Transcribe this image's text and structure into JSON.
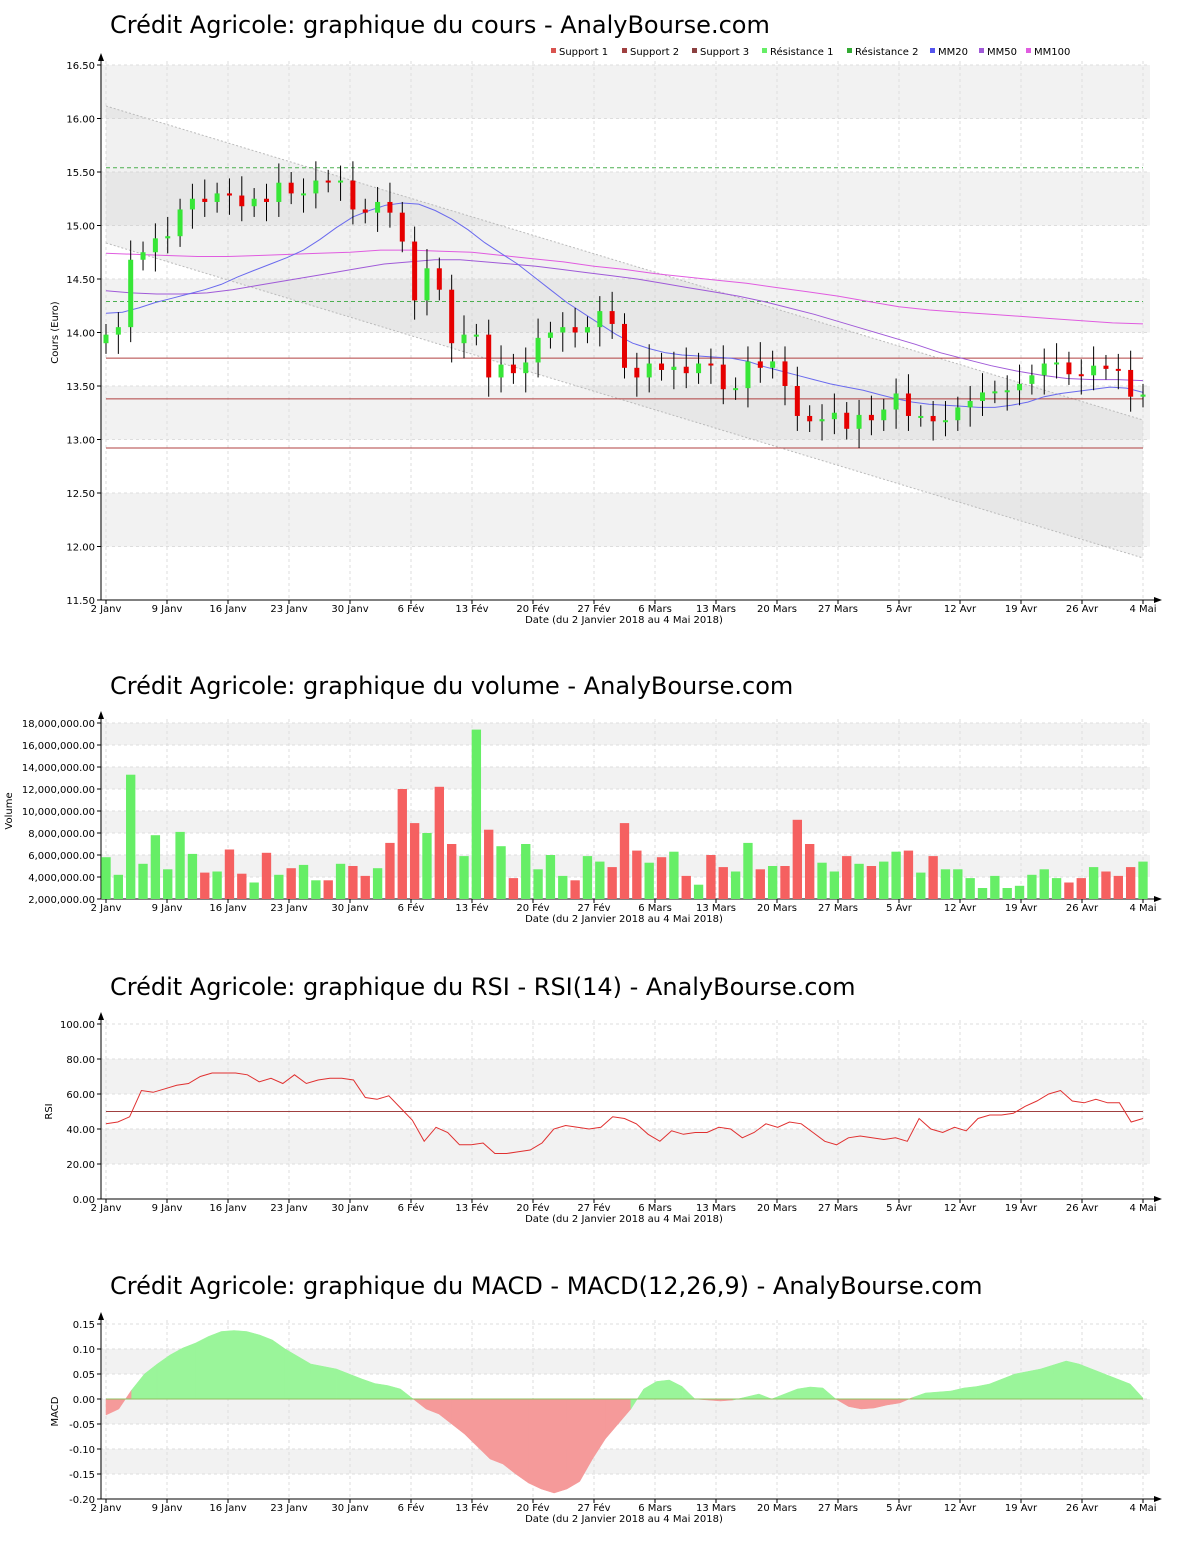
{
  "xaxis": {
    "label": "Date (du 2 Janvier 2018 au 4 Mai 2018)",
    "ticks": [
      "2 Janv",
      "9 Janv",
      "16 Janv",
      "23 Janv",
      "30 Janv",
      "6 Fév",
      "13 Fév",
      "20 Fév",
      "27 Fév",
      "6 Mars",
      "13 Mars",
      "20 Mars",
      "27 Mars",
      "5 Avr",
      "12 Avr",
      "19 Avr",
      "26 Avr",
      "4 Mai"
    ]
  },
  "colors": {
    "up": "#37e637",
    "down": "#e60000",
    "support": "#b04040",
    "resistance": "#4caf50",
    "mm20": "#6a6aee",
    "mm50": "#a05ad8",
    "mm100": "#e05ce0",
    "rsi": "#e03030",
    "macd_pos": "#9af59a",
    "macd_neg": "#f59a9a",
    "vol_up": "#66ee66",
    "vol_down": "#f56060"
  },
  "chart_data": [
    {
      "type": "candlestick",
      "title": "Crédit Agricole: graphique du cours - AnalyBourse.com",
      "ylabel": "Cours (Euro)",
      "xlabel": "Date (du 2 Janvier 2018 au 4 Mai 2018)",
      "ylim": [
        11.5,
        16.5
      ],
      "yticks": [
        "11.50",
        "12.00",
        "12.50",
        "13.00",
        "13.50",
        "14.00",
        "14.50",
        "15.00",
        "15.50",
        "16.00",
        "16.50"
      ],
      "legend": [
        "Support 1",
        "Support 2",
        "Support 3",
        "Résistance 1",
        "Résistance 2",
        "MM20",
        "MM50",
        "MM100"
      ],
      "legend_colors": [
        "#d9534f",
        "#a04040",
        "#8b4040",
        "#66ee66",
        "#33aa33",
        "#5555ee",
        "#a05ad8",
        "#e05ce0"
      ],
      "legend_position": "top-right",
      "support": [
        13.76,
        13.38,
        12.92
      ],
      "resistance": [
        14.29,
        15.54
      ],
      "close": [
        13.98,
        14.05,
        14.68,
        14.75,
        14.88,
        14.9,
        15.15,
        15.25,
        15.22,
        15.3,
        15.28,
        15.18,
        15.25,
        15.22,
        15.4,
        15.3,
        15.3,
        15.42,
        15.41,
        15.42,
        15.15,
        15.12,
        15.22,
        15.12,
        14.85,
        14.3,
        14.6,
        14.4,
        13.9,
        13.98,
        13.98,
        13.58,
        13.7,
        13.62,
        13.72,
        13.95,
        14.0,
        14.05,
        14.0,
        14.05,
        14.2,
        14.08,
        13.67,
        13.58,
        13.71,
        13.65,
        13.68,
        13.62,
        13.71,
        13.7,
        13.47,
        13.48,
        13.73,
        13.67,
        13.73,
        13.5,
        13.22,
        13.17,
        13.19,
        13.25,
        13.1,
        13.23,
        13.18,
        13.28,
        13.43,
        13.22,
        13.22,
        13.17,
        13.18,
        13.3,
        13.36,
        13.44,
        13.45,
        13.46,
        13.52,
        13.6,
        13.71,
        13.72,
        13.61,
        13.6,
        13.69,
        13.66,
        13.65,
        13.4,
        13.42
      ],
      "ma20": [
        14.18,
        14.19,
        14.23,
        14.28,
        14.32,
        14.36,
        14.4,
        14.45,
        14.52,
        14.58,
        14.64,
        14.7,
        14.77,
        14.87,
        14.98,
        15.08,
        15.14,
        15.19,
        15.21,
        15.2,
        15.14,
        15.06,
        14.96,
        14.84,
        14.74,
        14.64,
        14.52,
        14.4,
        14.28,
        14.18,
        14.08,
        13.98,
        13.9,
        13.85,
        13.81,
        13.79,
        13.78,
        13.77,
        13.76,
        13.73,
        13.68,
        13.64,
        13.6,
        13.56,
        13.52,
        13.49,
        13.46,
        13.42,
        13.38,
        13.35,
        13.33,
        13.32,
        13.31,
        13.3,
        13.3,
        13.32,
        13.35,
        13.4,
        13.43,
        13.45,
        13.47,
        13.49,
        13.48,
        13.44
      ],
      "ma50": [
        14.39,
        14.37,
        14.36,
        14.36,
        14.37,
        14.4,
        14.44,
        14.48,
        14.52,
        14.56,
        14.6,
        14.64,
        14.66,
        14.68,
        14.68,
        14.66,
        14.64,
        14.62,
        14.59,
        14.56,
        14.53,
        14.5,
        14.46,
        14.42,
        14.38,
        14.34,
        14.29,
        14.23,
        14.17,
        14.1,
        14.03,
        13.96,
        13.89,
        13.81,
        13.75,
        13.69,
        13.64,
        13.6,
        13.57,
        13.56,
        13.56,
        13.55
      ],
      "ma100": [
        14.74,
        14.73,
        14.72,
        14.71,
        14.71,
        14.72,
        14.73,
        14.74,
        14.75,
        14.77,
        14.77,
        14.76,
        14.75,
        14.72,
        14.69,
        14.66,
        14.62,
        14.59,
        14.55,
        14.52,
        14.49,
        14.46,
        14.42,
        14.38,
        14.34,
        14.29,
        14.24,
        14.21,
        14.19,
        14.17,
        14.15,
        14.13,
        14.11,
        14.09,
        14.08
      ]
    },
    {
      "type": "bar",
      "title": "Crédit Agricole: graphique du volume - AnalyBourse.com",
      "ylabel": "Volume",
      "xlabel": "Date (du 2 Janvier 2018 au 4 Mai 2018)",
      "ylim": [
        2000000,
        18000000
      ],
      "yticks": [
        "2,000,000.00",
        "4,000,000.00",
        "6,000,000.00",
        "8,000,000.00",
        "10,000,000.00",
        "12,000,000.00",
        "14,000,000.00",
        "16,000,000.00",
        "18,000,000.00"
      ],
      "values": [
        5800000,
        4200000,
        13300000,
        5200000,
        7800000,
        4700000,
        8100000,
        6100000,
        4400000,
        4500000,
        6500000,
        4300000,
        3500000,
        6200000,
        4200000,
        4800000,
        5100000,
        3700000,
        3700000,
        5200000,
        5000000,
        4100000,
        4800000,
        7100000,
        12000000,
        8900000,
        8000000,
        12200000,
        7000000,
        5900000,
        17400000,
        8300000,
        6800000,
        3900000,
        7000000,
        4700000,
        6000000,
        4100000,
        3700000,
        5900000,
        5400000,
        4900000,
        8900000,
        6400000,
        5300000,
        5800000,
        6300000,
        4100000,
        3300000,
        6000000,
        4900000,
        4500000,
        7100000,
        4700000,
        5000000,
        5000000,
        9200000,
        7000000,
        5300000,
        4500000,
        5900000,
        5200000,
        5000000,
        5400000,
        6300000,
        6400000,
        4400000,
        5900000,
        4700000,
        4700000,
        3900000,
        3000000,
        4100000,
        3000000,
        3200000,
        4200000,
        4700000,
        3900000,
        3500000,
        3900000,
        4900000,
        4500000,
        4100000,
        4900000,
        5400000
      ]
    },
    {
      "type": "line",
      "title": "Crédit Agricole: graphique du RSI - RSI(14) - AnalyBourse.com",
      "ylabel": "RSI",
      "xlabel": "Date (du 2 Janvier 2018 au 4 Mai 2018)",
      "ylim": [
        0,
        100
      ],
      "yticks": [
        "0.00",
        "20.00",
        "40.00",
        "60.00",
        "80.00",
        "100.00"
      ],
      "reference_line": 50,
      "values": [
        43,
        44,
        47,
        62,
        61,
        63,
        65,
        66,
        70,
        72,
        72,
        72,
        71,
        67,
        69,
        66,
        71,
        66,
        68,
        69,
        69,
        68,
        58,
        57,
        59,
        52,
        45,
        33,
        41,
        38,
        31,
        31,
        32,
        26,
        26,
        27,
        28,
        32,
        40,
        42,
        41,
        40,
        41,
        47,
        46,
        43,
        37,
        33,
        39,
        37,
        38,
        38,
        41,
        40,
        35,
        38,
        43,
        41,
        44,
        43,
        38,
        33,
        31,
        35,
        36,
        35,
        34,
        35,
        33,
        46,
        40,
        38,
        41,
        39,
        46,
        48,
        48,
        49,
        53,
        56,
        60,
        62,
        56,
        55,
        57,
        55,
        55,
        44,
        46
      ]
    },
    {
      "type": "area",
      "title": "Crédit Agricole: graphique du MACD - MACD(12,26,9) - AnalyBourse.com",
      "ylabel": "MACD",
      "xlabel": "Date (du 2 Janvier 2018 au 4 Mai 2018)",
      "ylim": [
        -0.2,
        0.15
      ],
      "yticks": [
        "-0.20",
        "-0.15",
        "-0.10",
        "-0.05",
        "0.00",
        "0.05",
        "0.10",
        "0.15"
      ],
      "values": [
        -0.032,
        -0.02,
        0.018,
        0.05,
        0.07,
        0.088,
        0.102,
        0.112,
        0.125,
        0.135,
        0.137,
        0.135,
        0.128,
        0.118,
        0.1,
        0.085,
        0.07,
        0.065,
        0.06,
        0.05,
        0.04,
        0.031,
        0.027,
        0.02,
        0.0,
        -0.02,
        -0.03,
        -0.05,
        -0.07,
        -0.095,
        -0.12,
        -0.13,
        -0.15,
        -0.168,
        -0.18,
        -0.188,
        -0.18,
        -0.165,
        -0.12,
        -0.08,
        -0.05,
        -0.02,
        0.02,
        0.035,
        0.038,
        0.025,
        0.0,
        -0.002,
        -0.004,
        -0.002,
        0.004,
        0.01,
        0.0,
        0.01,
        0.02,
        0.024,
        0.022,
        0.0,
        -0.015,
        -0.02,
        -0.018,
        -0.012,
        -0.008,
        0.003,
        0.012,
        0.014,
        0.016,
        0.022,
        0.025,
        0.03,
        0.04,
        0.05,
        0.055,
        0.06,
        0.068,
        0.076,
        0.07,
        0.06,
        0.05,
        0.04,
        0.03,
        0.002
      ]
    }
  ]
}
